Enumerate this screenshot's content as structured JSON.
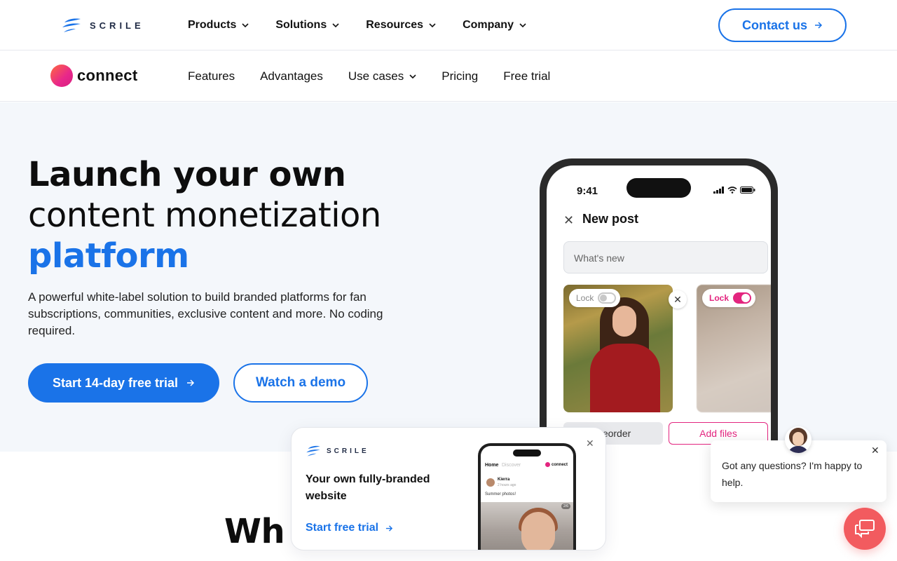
{
  "brand": {
    "name": "SCRILE"
  },
  "topnav": {
    "items": [
      {
        "label": "Products"
      },
      {
        "label": "Solutions"
      },
      {
        "label": "Resources"
      },
      {
        "label": "Company"
      }
    ],
    "contact_label": "Contact us"
  },
  "subnav": {
    "product_name": "connect",
    "items": [
      {
        "label": "Features"
      },
      {
        "label": "Advantages"
      },
      {
        "label": "Use cases"
      },
      {
        "label": "Pricing"
      },
      {
        "label": "Free trial"
      }
    ]
  },
  "hero": {
    "title_line1": "Launch your own",
    "title_line2": "content monetization",
    "title_line3": "platform",
    "lead": "A powerful white-label solution to build branded platforms for fan subscriptions, communities, exclusive content and more. No coding required.",
    "primary_cta": "Start 14-day free trial",
    "secondary_cta": "Watch a demo"
  },
  "phone": {
    "time": "9:41",
    "screen_title": "New post",
    "input_placeholder": "What's new",
    "lock_label_1": "Lock",
    "lock_label_2": "Lock",
    "lock1_on": false,
    "lock2_on": true,
    "reorder_label": "Reorder",
    "add_files_label": "Add files"
  },
  "lower": {
    "title_visible": "Wh                              t for"
  },
  "popup": {
    "logo": "SCRILE",
    "title": "Your own fully-branded website",
    "link": "Start free trial",
    "mini_phone": {
      "tab_home": "Home",
      "tab_discover": "Discover",
      "brand": "connect",
      "author": "Kierra",
      "time": "2 hours ago",
      "text": "Summer photos!",
      "counter": "2/6"
    }
  },
  "chat": {
    "message": "Got any questions? I'm happy to help."
  },
  "colors": {
    "accent": "#1a73e8",
    "brand_pink": "#e3257f",
    "chat_red": "#f25b5f",
    "hero_bg": "#f4f7fb"
  }
}
